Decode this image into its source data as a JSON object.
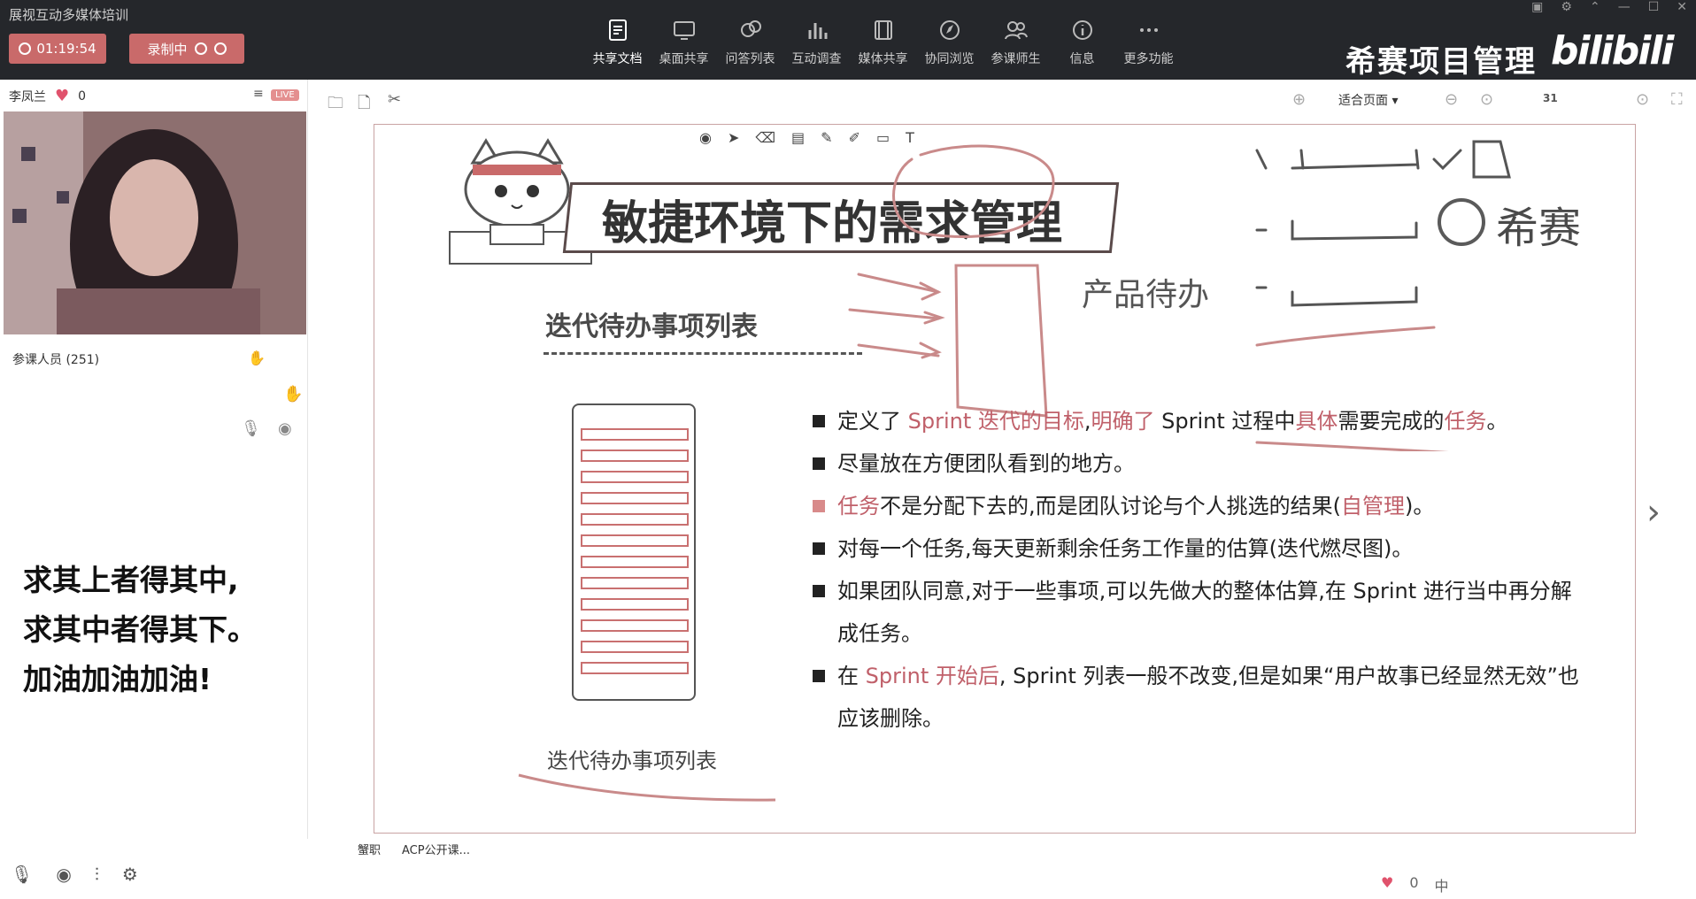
{
  "app": {
    "title": "展视互动多媒体培训"
  },
  "recording": {
    "timer": "01:19:54",
    "status": "录制中"
  },
  "toolbar": {
    "items": [
      {
        "label": "共享文档",
        "icon": "share-doc-icon"
      },
      {
        "label": "桌面共享",
        "icon": "desktop-share-icon"
      },
      {
        "label": "问答列表",
        "icon": "qa-list-icon"
      },
      {
        "label": "互动调查",
        "icon": "survey-icon"
      },
      {
        "label": "媒体共享",
        "icon": "media-share-icon"
      },
      {
        "label": "协同浏览",
        "icon": "co-browse-icon"
      },
      {
        "label": "参课师生",
        "icon": "participants-icon"
      },
      {
        "label": "信息",
        "icon": "info-icon"
      },
      {
        "label": "更多功能",
        "icon": "more-icon"
      }
    ]
  },
  "brand": {
    "name": "希赛项目管理",
    "bili": "bilibili"
  },
  "presenter": {
    "name": "李凤兰",
    "likes": "0",
    "live_badge": "LIVE"
  },
  "attendees": {
    "label": "参课人员 (251)"
  },
  "motto": {
    "line1": "求其上者得其中,",
    "line2": "求其中者得其下。",
    "line3": "加油加油加油!"
  },
  "docbar": {
    "zoom": "适合页面",
    "page": "31"
  },
  "slide": {
    "title": "敏捷环境下的需求管理",
    "logo": "希赛",
    "subtitle": "迭代待办事项列表",
    "handwritten": "产品待办",
    "stack_caption": "迭代待办事项列表",
    "bullets": [
      {
        "parts": [
          {
            "t": "定义了 "
          },
          {
            "t": "Sprint 迭代的目标",
            "h": true
          },
          {
            "t": ","
          },
          {
            "t": "明确了",
            "h": true
          },
          {
            "t": " Sprint 过程中"
          },
          {
            "t": "具体",
            "h": true
          },
          {
            "t": "需要完成的"
          },
          {
            "t": "任务",
            "h": true
          },
          {
            "t": "。"
          }
        ]
      },
      {
        "parts": [
          {
            "t": "尽量放在方便团队看到的地方。"
          }
        ]
      },
      {
        "pink": true,
        "parts": [
          {
            "t": "任务",
            "h": true
          },
          {
            "t": "不是分配下去的,而是团队讨论与个人挑选的结果("
          },
          {
            "t": "自管理",
            "h": true
          },
          {
            "t": ")。"
          }
        ]
      },
      {
        "parts": [
          {
            "t": "对每一个任务,每天更新剩余任务工作量的估算(迭代燃尽图)。"
          }
        ]
      },
      {
        "parts": [
          {
            "t": "如果团队同意,对于一些事项,可以先做大的整体估算,在 Sprint 进行当中再分解成任务。"
          }
        ]
      },
      {
        "parts": [
          {
            "t": "在 "
          },
          {
            "t": "Sprint 开始后",
            "h": true
          },
          {
            "t": ", Sprint 列表一般不改变,但是如果“用户故事已经显然无效”也应该删除。"
          }
        ]
      }
    ]
  },
  "bottom": {
    "tab1": "蟹职",
    "tab2": "ACP公开课...",
    "likes": "0",
    "ime": "中"
  },
  "colors": {
    "topbar": "#25272b",
    "accent": "#c96a6a",
    "highlight": "#c0606a"
  }
}
